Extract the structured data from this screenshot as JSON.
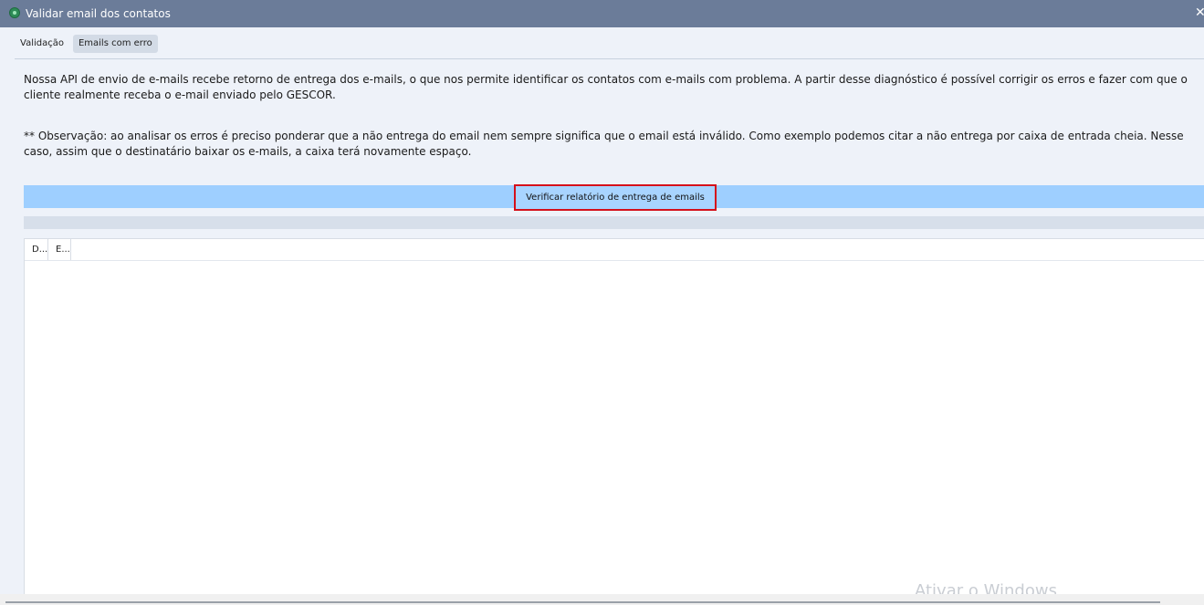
{
  "window": {
    "title": "Validar email dos contatos",
    "app_icon": "app-globe-icon",
    "close_label": "✕"
  },
  "tabs": [
    {
      "label": "Validação",
      "active": false
    },
    {
      "label": "Emails com erro",
      "active": true
    }
  ],
  "description": {
    "paragraph": "Nossa API de envio de e-mails recebe retorno de entrega dos e-mails, o que nos permite identificar os contatos com e-mails com problema. A partir desse diagnóstico é possível corrigir os erros e fazer com que o cliente realmente receba o e-mail enviado pelo GESCOR.",
    "note": "** Observação: ao analisar os erros é preciso ponderar que a não entrega do email nem sempre significa que o email está inválido. Como exemplo podemos citar a não entrega por caixa de entrada cheia. Nesse caso, assim que o destinatário baixar os e-mails, a caixa terá novamente espaço."
  },
  "actions": {
    "verify_button_label": "Verificar relatório de entrega de emails"
  },
  "grid": {
    "columns": [
      "D...",
      "E..."
    ],
    "rows": []
  },
  "os_watermark": "Ativar o Windows",
  "colors": {
    "titlebar": "#6b7c99",
    "action_bar": "#9ecfff",
    "highlight_border": "#d5101a",
    "active_tab": "#d3dbe6"
  }
}
